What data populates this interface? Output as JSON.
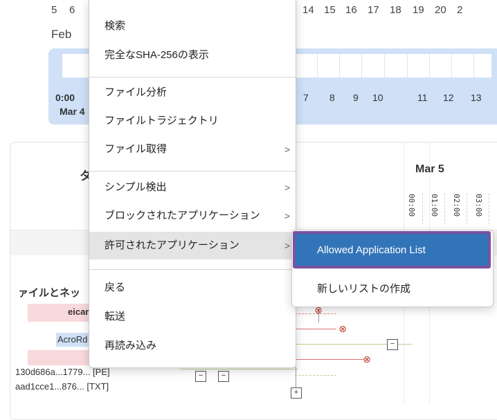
{
  "top_dates": {
    "left": [
      "5",
      "6"
    ],
    "right": [
      "14",
      "15",
      "16",
      "17",
      "18",
      "19",
      "20",
      "2"
    ],
    "month": "Feb"
  },
  "range_band": {
    "time": "0:00",
    "date": "Mar 4",
    "numbers": [
      "7",
      "8",
      "9",
      "10",
      "11",
      "12",
      "13"
    ]
  },
  "panel": {
    "title_fragment": "タ",
    "day_header": "Mar 5",
    "hours": [
      "00:00",
      "01:00",
      "02:00",
      "03:00"
    ],
    "section_title": "ァイルとネッ",
    "rows": [
      {
        "text": "eicar.",
        "bold": true
      },
      {
        "text": "AcroRd",
        "bold": false
      },
      {
        "text": "130d686a...1779... [PE]",
        "bold": false
      },
      {
        "text": "aad1cce1...876... [TXT]",
        "bold": false
      }
    ]
  },
  "context_menu": {
    "items": [
      {
        "label": "検索",
        "submenu": false
      },
      {
        "label": "完全なSHA-256の表示",
        "submenu": false
      },
      {
        "label": "ファイル分析",
        "submenu": false
      },
      {
        "label": "ファイルトラジェクトリ",
        "submenu": false
      },
      {
        "label": "ファイル取得",
        "submenu": true
      },
      {
        "label": "シンプル検出",
        "submenu": true
      },
      {
        "label": "ブロックされたアプリケーション",
        "submenu": true
      },
      {
        "label": "許可されたアプリケーション",
        "submenu": true
      },
      {
        "label": "戻る",
        "submenu": false
      },
      {
        "label": "転送",
        "submenu": false
      },
      {
        "label": "再読み込み",
        "submenu": false
      }
    ],
    "arrow_glyph": ">"
  },
  "submenu": {
    "items": [
      "Allowed Application List",
      "新しいリストの作成"
    ]
  },
  "colors": {
    "menu_highlight": "#3274b8",
    "focus_outline": "#7a529f",
    "range_band": "#cfe0f7",
    "pink_row": "#f8d9dc"
  }
}
